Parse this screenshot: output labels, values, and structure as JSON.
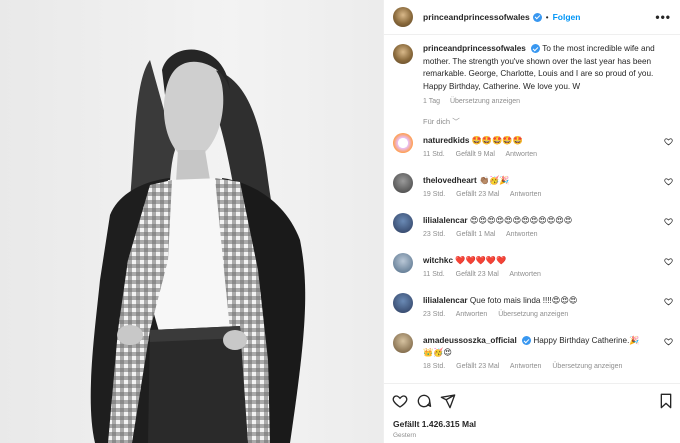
{
  "post": {
    "username": "princeandprincessofwales",
    "follow_label": "Folgen",
    "more_label": "•••",
    "caption_text": "To the most incredible wife and mother. The strength you've shown over the last year has been remarkable. George, Charlotte, Louis and I are so proud of you. Happy Birthday, Catherine. We love you. W",
    "caption_age": "1 Tag",
    "caption_translate": "Übersetzung anzeigen",
    "for_you_label": "Für dich",
    "likes": "Gefällt 1.426.315 Mal",
    "posted": "Gestern"
  },
  "comments": [
    {
      "username": "naturedkids",
      "text": "🤩🤩🤩🤩🤩",
      "age": "11 Std.",
      "likes": "Gefällt 9 Mal",
      "reply": "Antworten",
      "translate": ""
    },
    {
      "username": "thelovedheart",
      "text": "👏🏽🥳🎉",
      "age": "19 Std.",
      "likes": "Gefällt 23 Mal",
      "reply": "Antworten",
      "translate": ""
    },
    {
      "username": "lilialalencar",
      "text": "😍😍😍😍😍😍😍😍😍😍😍😍",
      "age": "23 Std.",
      "likes": "Gefällt 1 Mal",
      "reply": "Antworten",
      "translate": ""
    },
    {
      "username": "witchkc",
      "text": "❤️❤️❤️❤️❤️",
      "age": "11 Std.",
      "likes": "Gefällt 23 Mal",
      "reply": "Antworten",
      "translate": ""
    },
    {
      "username": "lilialalencar",
      "text": "Que foto mais linda !!!!😍😍😍",
      "age": "23 Std.",
      "likes": "",
      "reply": "Antworten",
      "translate": "Übersetzung anzeigen"
    },
    {
      "username": "amadeussoszka_official",
      "text": "Happy Birthday Catherine.🎉👑🥳😍",
      "age": "18 Std.",
      "likes": "Gefällt 23 Mal",
      "reply": "Antworten",
      "translate": "Übersetzung anzeigen"
    }
  ],
  "icons": {
    "like": "heart-icon",
    "comment": "comment-icon",
    "share": "share-icon",
    "save": "bookmark-icon",
    "verified": "verified-badge-icon",
    "more": "more-options-icon"
  },
  "colors": {
    "accent": "#0095f6",
    "verified": "#3897f0",
    "muted": "#8e8e8e",
    "text": "#262626"
  }
}
